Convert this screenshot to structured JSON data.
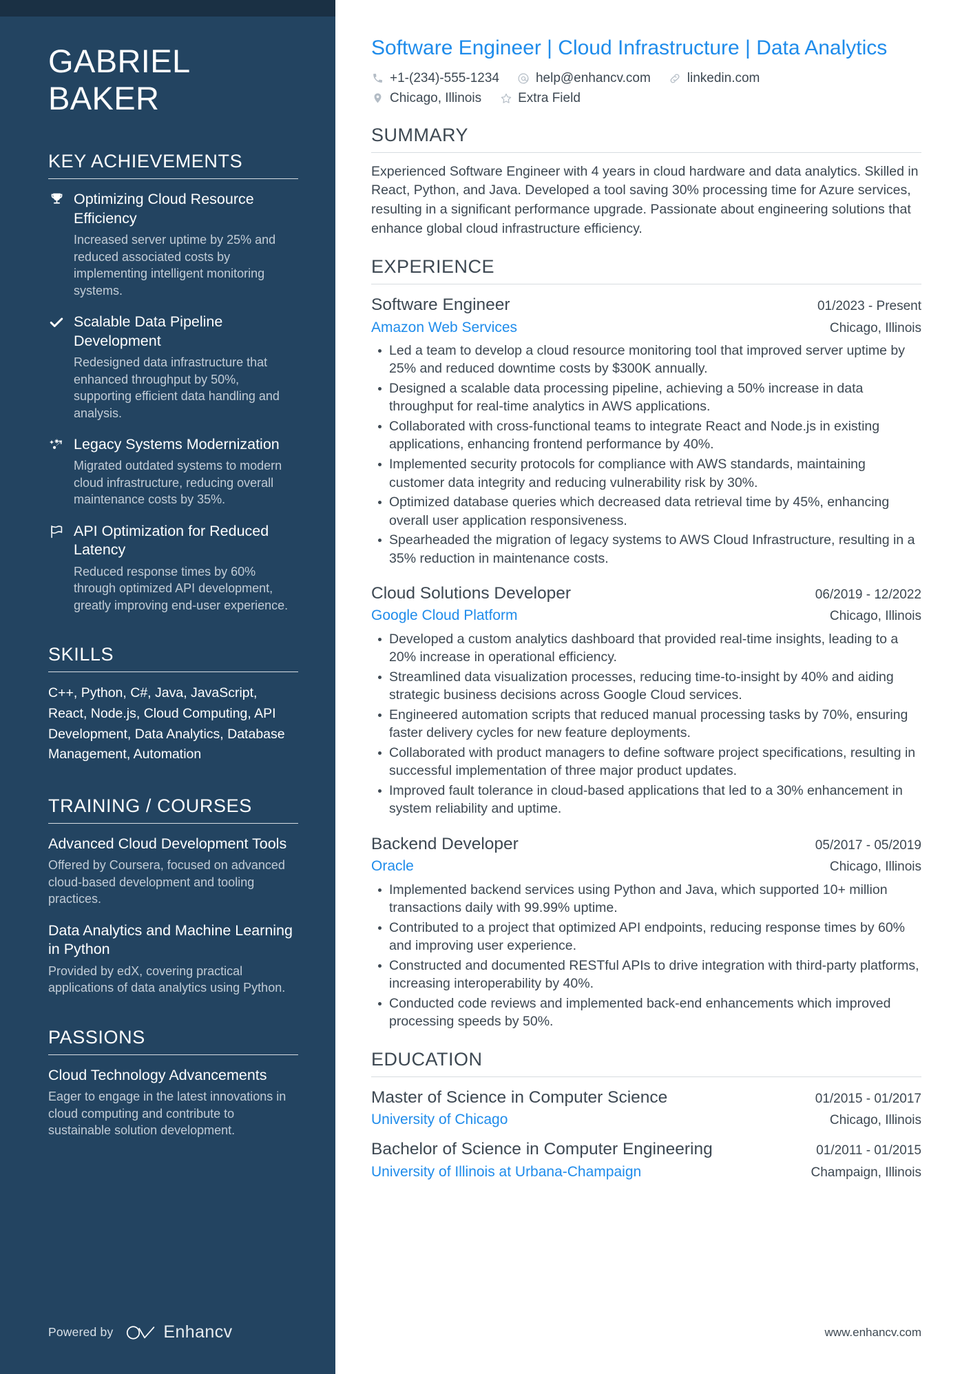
{
  "colors": {
    "sidebar_bg": "#234461",
    "sidebar_topbar": "#1a3044",
    "accent_blue": "#1f8ceb",
    "body_text": "#3d4852",
    "muted_text": "#c2ccd6"
  },
  "sidebar": {
    "name_line1": "GABRIEL",
    "name_line2": "BAKER",
    "key_achievements": {
      "heading": "KEY ACHIEVEMENTS",
      "items": [
        {
          "icon": "trophy-icon",
          "title": "Optimizing Cloud Resource Efficiency",
          "description": "Increased server uptime by 25% and reduced associated costs by implementing intelligent monitoring systems."
        },
        {
          "icon": "check-icon",
          "title": "Scalable Data Pipeline Development",
          "description": "Redesigned data infrastructure that enhanced throughput by 50%, supporting efficient data handling and analysis."
        },
        {
          "icon": "sparkle-arrow-icon",
          "title": "Legacy Systems Modernization",
          "description": "Migrated outdated systems to modern cloud infrastructure, reducing overall maintenance costs by 35%."
        },
        {
          "icon": "flag-icon",
          "title": "API Optimization for Reduced Latency",
          "description": "Reduced response times by 60% through optimized API development, greatly improving end-user experience."
        }
      ]
    },
    "skills": {
      "heading": "SKILLS",
      "text": "C++, Python, C#, Java, JavaScript, React, Node.js, Cloud Computing, API Development, Data Analytics, Database Management, Automation"
    },
    "training": {
      "heading": "TRAINING / COURSES",
      "items": [
        {
          "title": "Advanced Cloud Development Tools",
          "description": "Offered by Coursera, focused on advanced cloud-based development and tooling practices."
        },
        {
          "title": "Data Analytics and Machine Learning in Python",
          "description": "Provided by edX, covering practical applications of data analytics using Python."
        }
      ]
    },
    "passions": {
      "heading": "PASSIONS",
      "items": [
        {
          "title": "Cloud Technology Advancements",
          "description": "Eager to engage in the latest innovations in cloud computing and contribute to sustainable solution development."
        }
      ]
    },
    "footer": {
      "powered_by": "Powered by",
      "brand": "Enhancv"
    }
  },
  "main": {
    "job_title": "Software Engineer | Cloud Infrastructure | Data Analytics",
    "contacts": {
      "row1": [
        {
          "icon": "phone-icon",
          "text": "+1-(234)-555-1234"
        },
        {
          "icon": "at-icon",
          "text": "help@enhancv.com"
        },
        {
          "icon": "link-icon",
          "text": "linkedin.com"
        }
      ],
      "row2": [
        {
          "icon": "location-pin-icon",
          "text": "Chicago, Illinois"
        },
        {
          "icon": "star-icon",
          "text": "Extra Field"
        }
      ]
    },
    "summary": {
      "heading": "SUMMARY",
      "text": "Experienced Software Engineer with 4 years in cloud hardware and data analytics. Skilled in React, Python, and Java. Developed a tool saving 30% processing time for Azure services, resulting in a significant performance upgrade. Passionate about engineering solutions that enhance global cloud infrastructure efficiency."
    },
    "experience": {
      "heading": "EXPERIENCE",
      "entries": [
        {
          "role": "Software Engineer",
          "date": "01/2023 - Present",
          "organization": "Amazon Web Services",
          "location": "Chicago, Illinois",
          "bullets": [
            "Led a team to develop a cloud resource monitoring tool that improved server uptime by 25% and reduced downtime costs by $300K annually.",
            "Designed a scalable data processing pipeline, achieving a 50% increase in data throughput for real-time analytics in AWS applications.",
            "Collaborated with cross-functional teams to integrate React and Node.js in existing applications, enhancing frontend performance by 40%.",
            "Implemented security protocols for compliance with AWS standards, maintaining customer data integrity and reducing vulnerability risk by 30%.",
            "Optimized database queries which decreased data retrieval time by 45%, enhancing overall user application responsiveness.",
            "Spearheaded the migration of legacy systems to AWS Cloud Infrastructure, resulting in a 35% reduction in maintenance costs."
          ]
        },
        {
          "role": "Cloud Solutions Developer",
          "date": "06/2019 - 12/2022",
          "organization": "Google Cloud Platform",
          "location": "Chicago, Illinois",
          "bullets": [
            "Developed a custom analytics dashboard that provided real-time insights, leading to a 20% increase in operational efficiency.",
            "Streamlined data visualization processes, reducing time-to-insight by 40% and aiding strategic business decisions across Google Cloud services.",
            "Engineered automation scripts that reduced manual processing tasks by 70%, ensuring faster delivery cycles for new feature deployments.",
            "Collaborated with product managers to define software project specifications, resulting in successful implementation of three major product updates.",
            "Improved fault tolerance in cloud-based applications that led to a 30% enhancement in system reliability and uptime."
          ]
        },
        {
          "role": "Backend Developer",
          "date": "05/2017 - 05/2019",
          "organization": "Oracle",
          "location": "Chicago, Illinois",
          "bullets": [
            "Implemented backend services using Python and Java, which supported 10+ million transactions daily with 99.99% uptime.",
            "Contributed to a project that optimized API endpoints, reducing response times by 60% and improving user experience.",
            "Constructed and documented RESTful APIs to drive integration with third-party platforms, increasing interoperability by 40%.",
            "Conducted code reviews and implemented back-end enhancements which improved processing speeds by 50%."
          ]
        }
      ]
    },
    "education": {
      "heading": "EDUCATION",
      "entries": [
        {
          "degree": "Master of Science in Computer Science",
          "date": "01/2015 - 01/2017",
          "institution": "University of Chicago",
          "location": "Chicago, Illinois"
        },
        {
          "degree": "Bachelor of Science in Computer Engineering",
          "date": "01/2011 - 01/2015",
          "institution": "University of Illinois at Urbana-Champaign",
          "location": "Champaign, Illinois"
        }
      ]
    },
    "site_url": "www.enhancv.com"
  }
}
